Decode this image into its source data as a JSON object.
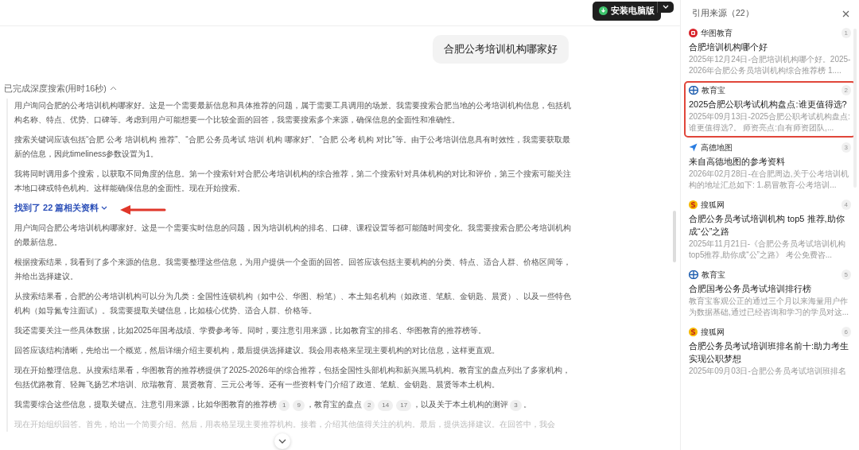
{
  "top_bar": {
    "install_button": "安装电脑版"
  },
  "user_message": "合肥公考培训机构哪家好",
  "thinking": {
    "header": "已完成深度搜索(用时16秒)",
    "expanded": true,
    "paragraphs": [
      {
        "parts": [
          {
            "kind": "text",
            "text": "用户询问合肥的公考培训机构哪家好。这是一个需要最新信息和具体推荐的问题，属于需要工具调用的场景。我需要搜索合肥当地的公考培训机构信息，包括机构名称、特点、优势、口碑等。考虑到用户可能想要一个比较全面的回答，我需要搜索多个来源，确保信息的全面性和准确性。"
          }
        ]
      },
      {
        "parts": [
          {
            "kind": "text",
            "text": "搜索关键词应该包括“合肥 公考 培训机构 推荐”、“合肥 公务员考试 培训 机构 哪家好”、“合肥 公考 机构 对比”等。由于公考培训信息具有时效性，我需要获取最新的信息，因此timeliness参数设置为1。"
          }
        ]
      },
      {
        "parts": [
          {
            "kind": "text",
            "text": "我将同时调用多个搜索，以获取不同角度的信息。第一个搜索针对合肥公考培训机构的综合推荐，第二个搜索针对具体机构的对比和评价，第三个搜索可能关注本地口碑或特色机构。这样能确保信息的全面性。现在开始搜索。"
          }
        ]
      }
    ],
    "found_link": "找到了 22 篇相关资料",
    "more_paragraphs": [
      {
        "faded": false,
        "parts": [
          {
            "kind": "text",
            "text": "用户询问合肥公考培训机构哪家好。这是一个需要实时信息的问题，因为培训机构的排名、口碑、课程设置等都可能随时间变化。我需要搜索合肥公考培训机构的最新信息。"
          }
        ]
      },
      {
        "faded": false,
        "parts": [
          {
            "kind": "text",
            "text": "根据搜索结果，我看到了多个来源的信息。我需要整理这些信息，为用户提供一个全面的回答。回答应该包括主要机构的分类、特点、适合人群、价格区间等，并给出选择建议。"
          }
        ]
      },
      {
        "faded": false,
        "parts": [
          {
            "kind": "text",
            "text": "从搜索结果看，合肥的公考培训机构可以分为几类：全国性连锁机构（如中公、华图、粉笔）、本土知名机构（如政道、笔航、金钥匙、晨贤）、以及一些特色机构（如导氮专注面试）。我需要提取关键信息，比如核心优势、适合人群、价格等。"
          }
        ]
      },
      {
        "faded": false,
        "parts": [
          {
            "kind": "text",
            "text": "我还需要关注一些具体数据，比如2025年国考战绩、学费参考等。同时，要注意引用来源，比如教育宝的排名、华图教育的推荐榜等。"
          }
        ]
      },
      {
        "faded": false,
        "parts": [
          {
            "kind": "text",
            "text": "回答应该结构清晰，先给出一个概览，然后详细介绍主要机构，最后提供选择建议。我会用表格来呈现主要机构的对比信息，这样更直观。"
          }
        ]
      },
      {
        "faded": false,
        "parts": [
          {
            "kind": "text",
            "text": "现在开始整理信息。从搜索结果看，华图教育的推荐榜提供了2025-2026年的综合推荐，包括全国性头部机构和新兴黑马机构。教育宝的盘点列出了多家机构，包括优路教育、轻舞飞扬艺术培训、欣瑞教育、晨贤教育、三元公考等。还有一些资料专门介绍了政道、笔航、金钥匙、晨贤等本土机构。"
          }
        ]
      },
      {
        "faded": false,
        "parts": [
          {
            "kind": "text",
            "text": "我需要综合这些信息，提取关键点。注意引用来源，比如华图教育的推荐榜"
          },
          {
            "kind": "cite",
            "text": "1"
          },
          {
            "kind": "cite",
            "text": "9"
          },
          {
            "kind": "text",
            "text": "，教育宝的盘点"
          },
          {
            "kind": "cite",
            "text": "2"
          },
          {
            "kind": "cite",
            "text": "14"
          },
          {
            "kind": "cite",
            "text": "17"
          },
          {
            "kind": "text",
            "text": "，以及关于本土机构的测评"
          },
          {
            "kind": "cite",
            "text": "3"
          },
          {
            "kind": "text",
            "text": "。"
          }
        ]
      },
      {
        "faded": true,
        "parts": [
          {
            "kind": "text",
            "text": "现在开始组织回答。首先，给出一个简要介绍。然后，用表格呈现主要推荐机构。接着，介绍其他值得关注的机构。最后，提供选择建议。在回答中，我会"
          }
        ]
      }
    ]
  },
  "sources_panel": {
    "title": "引用来源（22）",
    "items": [
      {
        "site": "华图教育",
        "kind": "red-circle",
        "number": "1",
        "title": "合肥培训机构哪个好",
        "snippet": "2025年12月24日-合肥培训机构哪个好。2025-2026年合肥公务员培训机构综合推荐榜 1....",
        "highlighted": false
      },
      {
        "site": "教育宝",
        "kind": "blue-globe",
        "number": "2",
        "title": "2025合肥公职考试机构盘点:谁更值得选?",
        "snippet": "2025年09月13日-2025合肥公职考试机构盘点:谁更值得选?。 师资亮点:自有师资团队,...",
        "highlighted": true
      },
      {
        "site": "高德地图",
        "kind": "blue-arrow",
        "number": "3",
        "title": "来自高德地图的参考资料",
        "snippet": "2026年02月28日-在合肥周边,关于公考培训机构的地址汇总如下: 1.易冒教育-公考培训...",
        "highlighted": false
      },
      {
        "site": "搜狐网",
        "kind": "yellow-circle",
        "number": "4",
        "title": "合肥公务员考试培训机构 top5 推荐,助你成“公”之路",
        "snippet": "2025年11月21日-《合肥公务员考试培训机构top5推荐,助你成“公”之路》 考公免费咨...",
        "highlighted": false
      },
      {
        "site": "教育宝",
        "kind": "blue-globe",
        "number": "5",
        "title": "合肥国考公务员考试培训排行榜",
        "snippet": "教育宝客观公正的通过三个月以来海量用户作为数据基础,通过已经咨询和学习的学员对这...",
        "highlighted": false
      },
      {
        "site": "搜狐网",
        "kind": "yellow-circle",
        "number": "6",
        "title": "合肥公务员考试培训班排名前十:助力考生实现公职梦想",
        "snippet": "2025年09月03日-合肥公务员考试培训班排名",
        "highlighted": false
      }
    ]
  }
}
